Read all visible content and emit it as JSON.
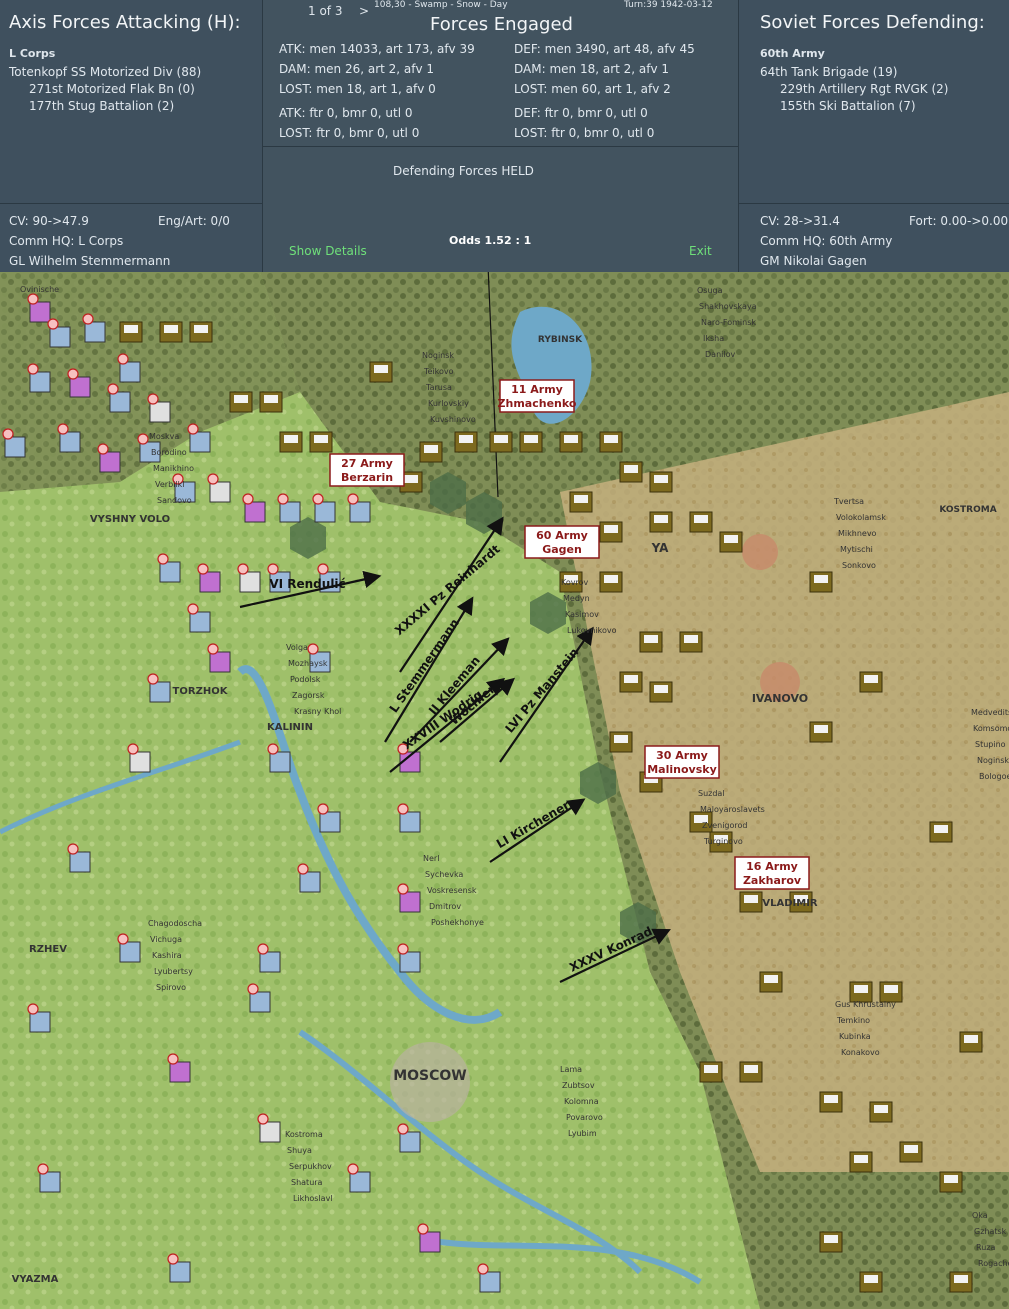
{
  "attacker": {
    "header": "Axis Forces Attacking (H):",
    "command": "L Corps",
    "units": [
      "Totenkopf SS Motorized Div (88)",
      "271st Motorized Flak Bn (0)",
      "177th Stug Battalion (2)"
    ],
    "cv": "CV: 90->47.9",
    "eng_art": "Eng/Art: 0/0",
    "comm_hq": "Comm HQ: L Corps",
    "leader": "GL Wilhelm Stemmermann"
  },
  "middle": {
    "pager": "1 of 3",
    "next_arrow": ">",
    "location": "108,30 - Swamp - Snow - Day",
    "turn": "Turn:39  1942-03-12",
    "title": "Forces Engaged",
    "atk_ground": "ATK: men 14033, art 173, afv 39",
    "dam_atk": "DAM: men 26, art 2, afv 1",
    "lost_atk": "LOST: men 18, art 1, afv 0",
    "atk_air": "ATK: ftr 0, bmr 0, utl 0",
    "lost_atk_air": "LOST: ftr 0, bmr 0, utl 0",
    "def_ground": "DEF: men 3490, art 48, afv 45",
    "dam_def": "DAM: men 18, art 2, afv 1",
    "lost_def": "LOST: men 60, art 1, afv 2",
    "def_air": "DEF: ftr 0, bmr 0, utl 0",
    "lost_def_air": "LOST: ftr 0, bmr 0, utl 0",
    "result": "Defending Forces HELD",
    "show_details": "Show Details",
    "odds": "Odds 1.52 : 1",
    "exit": "Exit"
  },
  "defender": {
    "header": "Soviet Forces Defending:",
    "command": "60th Army",
    "units": [
      "64th Tank Brigade (19)",
      "229th Artillery Rgt RVGK (2)",
      "155th Ski Battalion (7)"
    ],
    "cv": "CV: 28->31.4",
    "fort": "Fort: 0.00->0.00",
    "comm_hq": "Comm HQ: 60th Army",
    "leader": "GM Nikolai Gagen"
  },
  "map": {
    "army_labels": [
      {
        "name": "11 Army",
        "leader": "Zhmachenko"
      },
      {
        "name": "27 Army",
        "leader": "Berzarin"
      },
      {
        "name": "60 Army",
        "leader": "Gagen"
      },
      {
        "name": "30 Army",
        "leader": "Malinovsky"
      },
      {
        "name": "16 Army",
        "leader": "Zakharov"
      }
    ],
    "corps_arrows": [
      "VI Rendulić",
      "XXXXI Pz Reinhardt",
      "L Stemmermann",
      "II Kleeman",
      "XXVIII Wodrig",
      "LVI Pz Manstein",
      "LI Kirchener",
      "XXXV Konrad",
      "Wochler"
    ],
    "cities": [
      "MOSCOW",
      "KALININ",
      "TORZHOK",
      "IVANOVO",
      "KOSTROMA",
      "VLADIMIR",
      "RZHEV",
      "VYAZMA",
      "RYBINSK",
      "VYSHNY VOLO",
      "YA"
    ],
    "towns": [
      "Ovinische",
      "Sandovo",
      "Krasny Khol",
      "Poshekhonye",
      "Lyubim",
      "Danilov",
      "Sonkovo",
      "Bologoe",
      "Spirovo",
      "Likhoslavl",
      "Kuvshinovo",
      "Lukovnikovo",
      "Turginovo",
      "Konakovo",
      "Rogachevo",
      "Verbilki",
      "Zagorsk",
      "Dmitrov",
      "Povarovo",
      "Iksha",
      "Mytischi",
      "Noginsk",
      "Lyubertsy",
      "Shatura",
      "Kurlovskiy",
      "Kasimov",
      "Zvenigorod",
      "Kubinka",
      "Ruza",
      "Manikhino",
      "Podolsk",
      "Voskresensk",
      "Kolomna",
      "Naro-Fominsk",
      "Mikhnevo",
      "Stupino",
      "Kashira",
      "Serpukhov",
      "Tarusa",
      "Medyn",
      "Maloyaroslavets",
      "Temkino",
      "Gzhatsk",
      "Borodino",
      "Mozhaysk",
      "Sychevka",
      "Zubtsov",
      "Shakhovskaya",
      "Volokolamsk",
      "Komsomolsk",
      "Vichuga",
      "Shuya",
      "Teikovo",
      "Kovrov",
      "Suzdal",
      "Gus Khrustalny",
      "Oka",
      "Moskva",
      "Volga",
      "Nerl",
      "Lama",
      "Osuga",
      "Tvertsa",
      "Medveditsa",
      "Chagodoscha",
      "Kostroma",
      "Noginsk"
    ]
  },
  "colors": {
    "panel": "#3f505e",
    "link": "#6fe07a",
    "axis_counter": "#8a7a2a",
    "soviet_label": "#8b1a1a"
  }
}
